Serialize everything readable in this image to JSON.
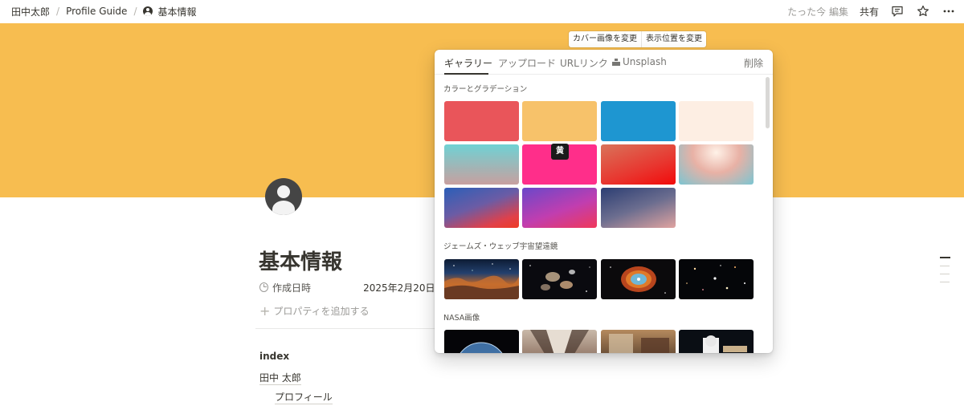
{
  "breadcrumb": {
    "workspace": "田中太郎",
    "section": "Profile Guide",
    "page": "基本情報",
    "separator": "/"
  },
  "topbar": {
    "edited": "たった今 編集",
    "share": "共有",
    "icons": [
      "comment-icon",
      "star-icon",
      "more-icon"
    ]
  },
  "cover": {
    "color": "#f7bd50",
    "change_cover": "カバー画像を変更",
    "reposition": "表示位置を変更"
  },
  "page": {
    "title": "基本情報",
    "icon": "user-circle-icon",
    "property_name": "作成日時",
    "property_value": "2025年2月20日 1",
    "add_property": "プロパティを追加する",
    "index_heading": "index",
    "toc_items": [
      "田中 太郎",
      "プロフィール"
    ]
  },
  "popup": {
    "tabs": {
      "gallery": "ギャラリー",
      "upload": "アップロード",
      "url": "URLリンク",
      "unsplash": "Unsplash",
      "remove": "削除"
    },
    "sections": {
      "colors": "カラーとグラデーション",
      "webb": "ジェームズ・ウェッブ宇宙望遠鏡",
      "nasa": "NASA画像"
    },
    "tooltip": "黄",
    "swatches": [
      {
        "name": "red",
        "fill": "#e9555a"
      },
      {
        "name": "yellow",
        "fill": "#f7c26a"
      },
      {
        "name": "blue",
        "fill": "#1e96d1"
      },
      {
        "name": "beige",
        "fill": "#fdeee3"
      },
      {
        "name": "gradient-teal",
        "fill": "linear-gradient(180deg,#6fd2d4 0%,#a4b3b4 60%,#c8a0a0 100%)"
      },
      {
        "name": "gradient-pink",
        "fill": "#ff2e8a"
      },
      {
        "name": "gradient-red",
        "fill": "linear-gradient(160deg,#d9735a 0%,#e8362f 60%,#f20a0a 100%)"
      },
      {
        "name": "gradient-rose",
        "fill": "radial-gradient(ellipse at 50% 20%,#fff2e8 0%,#e8b1a5 45%,#7bc5d2 100%)"
      },
      {
        "name": "gradient-blue-red",
        "fill": "linear-gradient(160deg,#2b5fb8 0%,#6b5ca5 45%,#e0404a 80%,#ee3b25 100%)"
      },
      {
        "name": "gradient-purple",
        "fill": "linear-gradient(160deg,#6a48c9 0%,#c03eb0 55%,#f0385a 100%)"
      },
      {
        "name": "gradient-dusk",
        "fill": "linear-gradient(160deg,#2c3e73 0%,#6b6d8f 50%,#e0a3a0 100%)"
      }
    ]
  }
}
